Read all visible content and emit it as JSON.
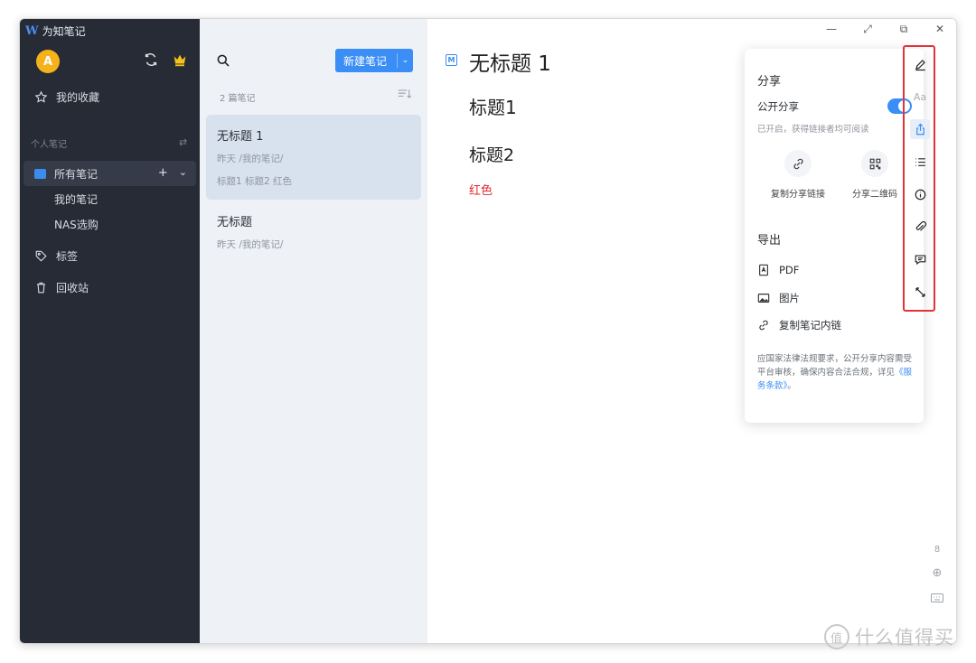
{
  "app": {
    "logo": "W",
    "title": "为知笔记",
    "avatar_letter": "A"
  },
  "sidebar": {
    "favorites": "我的收藏",
    "section_label": "个人笔记",
    "section_switch": "⇄",
    "all_notes": "所有笔记",
    "all_notes_add": "+",
    "all_notes_expand": "⌄",
    "sub_items": [
      "我的笔记",
      "NAS选购"
    ],
    "tags": "标签",
    "trash": "回收站"
  },
  "list": {
    "new_note_label": "新建笔记",
    "new_note_arrow": "⌄",
    "count": "2 篇笔记",
    "notes": [
      {
        "title": "无标题 1",
        "meta": "昨天  /我的笔记/",
        "snippet": "标题1 标题2 红色"
      },
      {
        "title": "无标题",
        "meta": "昨天  /我的笔记/",
        "snippet": ""
      }
    ]
  },
  "editor": {
    "badge": "M",
    "title": "无标题 1",
    "heading1": "标题1",
    "heading2": "标题2",
    "red_text": "红色",
    "red_color": "#e0292d"
  },
  "window_controls": {
    "minimize": "—",
    "fullscreen": "⤢",
    "restore": "⧉",
    "close": "✕"
  },
  "share_popup": {
    "header": "分享",
    "public_share_label": "公开分享",
    "public_share_on": true,
    "hint": "已开启，获得链接者均可阅读",
    "copy_link": "复制分享链接",
    "qr_code": "分享二维码",
    "export_header": "导出",
    "export_items": [
      "PDF",
      "图片",
      "复制笔记内链"
    ],
    "notice_text": "应国家法律法规要求，公开分享内容需受平台审核，确保内容合法合规，详见",
    "notice_link": "《服务条款》",
    "notice_end": "。"
  },
  "right_toolbar": {
    "font_label": "Aa",
    "bottom_number": "8"
  },
  "watermark": {
    "badge": "值",
    "text": "什么值得买"
  },
  "colors": {
    "accent": "#3a8ef6",
    "sidebar_bg": "#262b35",
    "list_bg": "#eef1f5",
    "highlight_border": "#e0343a"
  }
}
